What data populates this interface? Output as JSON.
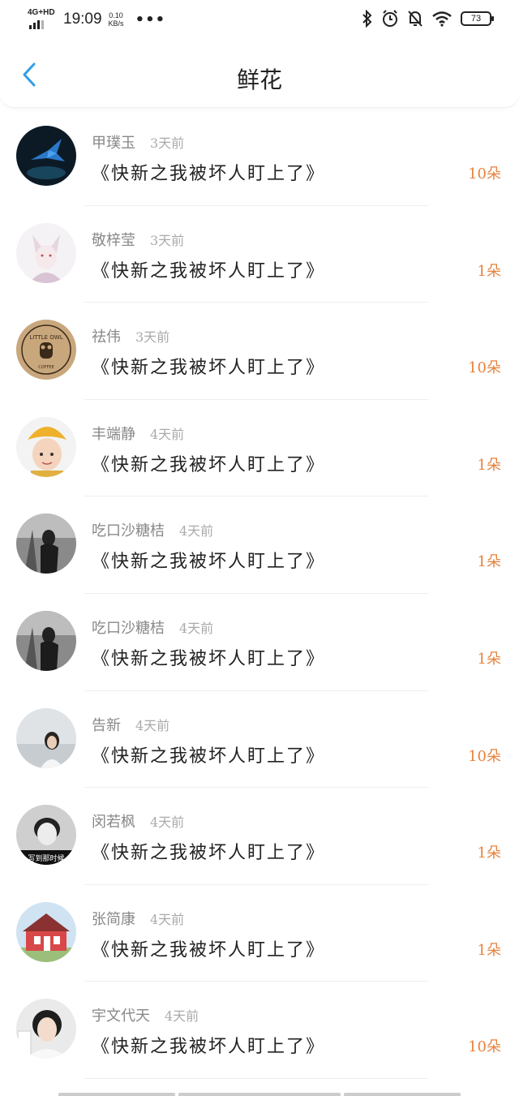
{
  "status_bar": {
    "network": "4G+HD",
    "time": "19:09",
    "speed_value": "0.10",
    "speed_unit": "KB/s",
    "more": "•••",
    "battery": "73",
    "icons": [
      "bluetooth-icon",
      "alarm-icon",
      "mute-bell-icon",
      "wifi-icon",
      "battery-icon"
    ]
  },
  "header": {
    "title": "鲜花",
    "back_icon": "chevron-left-icon",
    "accent_color": "#2f9ee8"
  },
  "items": [
    {
      "name": "甲璞玉",
      "time": "3天前",
      "book": "《快新之我被坏人盯上了》",
      "count": "10朵"
    },
    {
      "name": "敬梓莹",
      "time": "3天前",
      "book": "《快新之我被坏人盯上了》",
      "count": "1朵"
    },
    {
      "name": "祛伟",
      "time": "3天前",
      "book": "《快新之我被坏人盯上了》",
      "count": "10朵"
    },
    {
      "name": "丰端静",
      "time": "4天前",
      "book": "《快新之我被坏人盯上了》",
      "count": "1朵"
    },
    {
      "name": "吃口沙糖桔",
      "time": "4天前",
      "book": "《快新之我被坏人盯上了》",
      "count": "1朵"
    },
    {
      "name": "吃口沙糖桔",
      "time": "4天前",
      "book": "《快新之我被坏人盯上了》",
      "count": "1朵"
    },
    {
      "name": "告新",
      "time": "4天前",
      "book": "《快新之我被坏人盯上了》",
      "count": "10朵"
    },
    {
      "name": "闵若枫",
      "time": "4天前",
      "book": "《快新之我被坏人盯上了》",
      "count": "1朵"
    },
    {
      "name": "张简康",
      "time": "4天前",
      "book": "《快新之我被坏人盯上了》",
      "count": "1朵"
    },
    {
      "name": "宇文代天",
      "time": "4天前",
      "book": "《快新之我被坏人盯上了》",
      "count": "10朵"
    }
  ],
  "avatar_texts": {
    "owl_top": "LITTLE OWL",
    "owl_bottom": "COFFEE",
    "bw_caption": "写到那时候"
  },
  "colors": {
    "count": "#e7823c",
    "name": "#888888",
    "time": "#aaaaaa",
    "title": "#222222"
  }
}
